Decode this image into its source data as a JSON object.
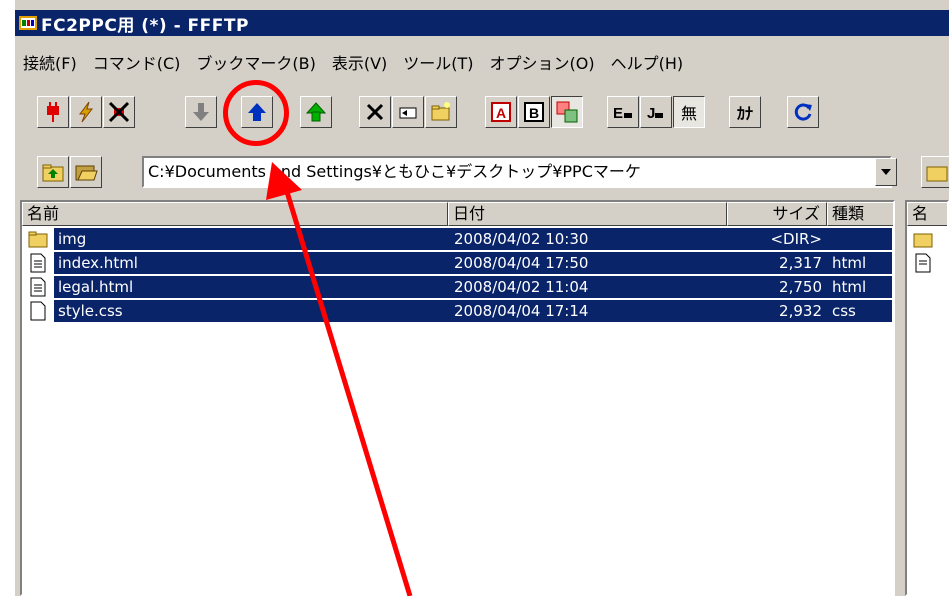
{
  "window": {
    "title": "FC2PPC用 (*) - FFFTP"
  },
  "menu": [
    "接続(F)",
    "コマンド(C)",
    "ブックマーク(B)",
    "表示(V)",
    "ツール(T)",
    "オプション(O)",
    "ヘルプ(H)"
  ],
  "toolbar": {
    "buttons": [
      {
        "name": "connect-button",
        "icon": "plug-icon"
      },
      {
        "name": "quick-connect-button",
        "icon": "lightning-icon"
      },
      {
        "name": "disconnect-button",
        "icon": "disconnect-icon"
      },
      {
        "name": "download-button",
        "icon": "down-arrow-icon"
      },
      {
        "name": "upload-button",
        "icon": "up-arrow-icon"
      },
      {
        "name": "mirror-upload-button",
        "icon": "green-up-arrow-icon"
      },
      {
        "name": "delete-button",
        "icon": "delete-x-icon"
      },
      {
        "name": "rename-button",
        "icon": "rename-icon"
      },
      {
        "name": "new-folder-button",
        "icon": "new-folder-icon"
      },
      {
        "name": "ascii-mode-button",
        "icon": "ascii-icon",
        "label": "A"
      },
      {
        "name": "binary-mode-button",
        "icon": "binary-icon",
        "label": "B"
      },
      {
        "name": "auto-mode-button",
        "icon": "auto-mode-icon"
      },
      {
        "name": "euc-button",
        "icon": "euc-icon",
        "label": "E"
      },
      {
        "name": "jis-button",
        "icon": "jis-icon",
        "label": "J"
      },
      {
        "name": "no-convert-button",
        "icon": "no-convert-icon",
        "label": "無"
      },
      {
        "name": "kana-button",
        "icon": "kana-icon",
        "label": "ｶﾅ"
      },
      {
        "name": "refresh-button",
        "icon": "refresh-icon"
      }
    ]
  },
  "local": {
    "path": "C:¥Documents and Settings¥ともひこ¥デスクトップ¥PPCマーケ",
    "columns": {
      "name": "名前",
      "date": "日付",
      "size": "サイズ",
      "type": "種類"
    },
    "files": [
      {
        "name": "img",
        "date": "2008/04/02 10:30",
        "size": "<DIR>",
        "type": "",
        "icon": "folder-icon"
      },
      {
        "name": "index.html",
        "date": "2008/04/04 17:50",
        "size": "2,317",
        "type": "html",
        "icon": "document-icon"
      },
      {
        "name": "legal.html",
        "date": "2008/04/02 11:04",
        "size": "2,750",
        "type": "html",
        "icon": "document-icon"
      },
      {
        "name": "style.css",
        "date": "2008/04/04 17:14",
        "size": "2,932",
        "type": "css",
        "icon": "file-icon"
      }
    ]
  },
  "remote": {
    "column_name_partial": "名"
  },
  "annotation": {
    "color": "#ff0000"
  }
}
